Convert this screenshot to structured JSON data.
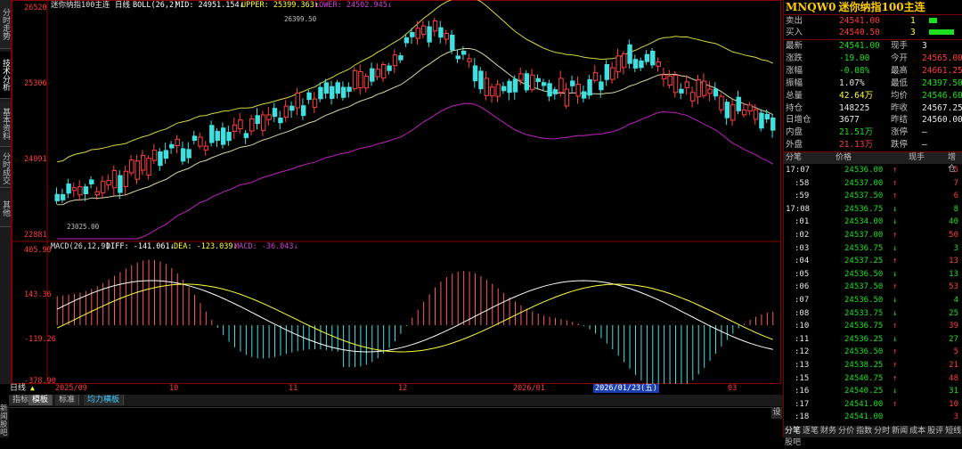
{
  "left_tabs": [
    {
      "label": "分时走势",
      "active": false
    },
    {
      "label": "技术分析",
      "active": true
    },
    {
      "label": "基本资料",
      "active": false
    },
    {
      "label": "分时成交",
      "active": false
    },
    {
      "label": "其他",
      "active": false
    }
  ],
  "main_chart": {
    "header": "迷你纳指100主连日线 BOLL(26,2) MID: 24951.154↓ UPPER: 25399.363↑ LOWER: 24502.945↓",
    "header_parts": {
      "name": "迷你纳指100主连",
      "period": "日线",
      "ind": "BOLL(26,2)",
      "mid": "MID: 24951.154↓",
      "upper": "UPPER: 25399.363↑",
      "lower": "LOWER: 24502.945↓"
    },
    "y_labels": [
      "26520",
      "25306",
      "24091",
      "22881"
    ],
    "high_note": "26399.50",
    "low_note": "23025.00"
  },
  "macd_chart": {
    "header_parts": {
      "name": "MACD(26,12,9)",
      "diff": "DIFF: -141.061↓",
      "dea": "DEA: -123.039↓",
      "macd": "MACD: -36.043↓"
    },
    "y_labels": [
      "405.90",
      "143.36",
      "-119.26",
      "-378.90"
    ]
  },
  "x_axis": {
    "period_label": "日线",
    "ticks": [
      "2025/09",
      "10",
      "11",
      "12",
      "2026/01",
      "2026/01/23(五)",
      "03"
    ]
  },
  "bottom_tabs": {
    "items": [
      "指标",
      "模板",
      "标准",
      "均力横板"
    ],
    "active": 1,
    "vert_left": "新闻 股吧",
    "right_btn": "设"
  },
  "quote": {
    "code": "MNQW0",
    "name": "迷你纳指100主连",
    "sell": {
      "label": "卖出",
      "price": "24541.00",
      "vol": "1"
    },
    "buy": {
      "label": "买入",
      "price": "24540.50",
      "vol": "3"
    },
    "rows": [
      {
        "l1": "最新",
        "v1": "24541.00",
        "c1": "grn",
        "l2": "现手",
        "v2": "3",
        "c2": "wht"
      },
      {
        "l1": "涨跌",
        "v1": "-19.00",
        "c1": "grn",
        "l2": "今开",
        "v2": "24565.00",
        "c2": "red"
      },
      {
        "l1": "涨幅",
        "v1": "-0.08%",
        "c1": "grn",
        "l2": "最高",
        "v2": "24661.25",
        "c2": "red"
      },
      {
        "l1": "振幅",
        "v1": "1.07%",
        "c1": "wht",
        "l2": "最低",
        "v2": "24397.50",
        "c2": "grn"
      },
      {
        "l1": "总量",
        "v1": "42.64万",
        "c1": "yel",
        "l2": "均价",
        "v2": "24546.60",
        "c2": "grn"
      },
      {
        "l1": "持仓",
        "v1": "148225",
        "c1": "wht",
        "l2": "昨收",
        "v2": "24567.25",
        "c2": "wht"
      },
      {
        "l1": "日增仓",
        "v1": "3677",
        "c1": "wht",
        "l2": "昨结",
        "v2": "24560.00",
        "c2": "wht"
      },
      {
        "l1": "内盘",
        "v1": "21.51万",
        "c1": "grn",
        "l2": "涨停",
        "v2": "—",
        "c2": "wht"
      },
      {
        "l1": "外盘",
        "v1": "21.13万",
        "c1": "red",
        "l2": "跌停",
        "v2": "—",
        "c2": "wht"
      }
    ]
  },
  "ticks_table": {
    "headers": [
      "分笔",
      "价格",
      "现手",
      "增仓"
    ],
    "rows": [
      {
        "t": "17:07",
        "p": "24536.00",
        "d": "↑",
        "v": "5",
        "c": "red"
      },
      {
        "t": ":58",
        "p": "24537.00",
        "d": "↑",
        "v": "7",
        "c": "red"
      },
      {
        "t": ":59",
        "p": "24537.50",
        "d": "↑",
        "v": "6",
        "c": "red"
      },
      {
        "t": "17:08",
        "p": "24536.75",
        "d": "↓",
        "v": "8",
        "c": "grn"
      },
      {
        "t": ":01",
        "p": "24534.00",
        "d": "↓",
        "v": "40",
        "c": "grn"
      },
      {
        "t": ":02",
        "p": "24537.00",
        "d": "↑",
        "v": "50",
        "c": "red"
      },
      {
        "t": ":03",
        "p": "24536.75",
        "d": "↓",
        "v": "3",
        "c": "grn"
      },
      {
        "t": ":04",
        "p": "24537.25",
        "d": "↑",
        "v": "13",
        "c": "red"
      },
      {
        "t": ":05",
        "p": "24536.50",
        "d": "↓",
        "v": "13",
        "c": "grn"
      },
      {
        "t": ":06",
        "p": "24537.50",
        "d": "↑",
        "v": "53",
        "c": "red"
      },
      {
        "t": ":07",
        "p": "24536.50",
        "d": "↓",
        "v": "4",
        "c": "grn"
      },
      {
        "t": ":08",
        "p": "24533.75",
        "d": "↓",
        "v": "25",
        "c": "grn"
      },
      {
        "t": ":10",
        "p": "24536.75",
        "d": "↑",
        "v": "39",
        "c": "red"
      },
      {
        "t": ":11",
        "p": "24536.25",
        "d": "↓",
        "v": "27",
        "c": "grn"
      },
      {
        "t": ":12",
        "p": "24536.50",
        "d": "↑",
        "v": "5",
        "c": "red"
      },
      {
        "t": ":13",
        "p": "24538.25",
        "d": "↑",
        "v": "21",
        "c": "red"
      },
      {
        "t": ":15",
        "p": "24540.75",
        "d": "↑",
        "v": "48",
        "c": "red"
      },
      {
        "t": ":16",
        "p": "24540.25",
        "d": "↓",
        "v": "31",
        "c": "grn"
      },
      {
        "t": ":17",
        "p": "24541.00",
        "d": "↑",
        "v": "10",
        "c": "red"
      },
      {
        "t": ":18",
        "p": "24541.00",
        "d": "",
        "v": "3",
        "c": "red"
      }
    ]
  },
  "right_bottom_tabs": [
    "分笔",
    "逐笔",
    "财务",
    "分价",
    "指数",
    "分时",
    "新闻",
    "成本",
    "股评",
    "短线",
    "股吧"
  ]
}
